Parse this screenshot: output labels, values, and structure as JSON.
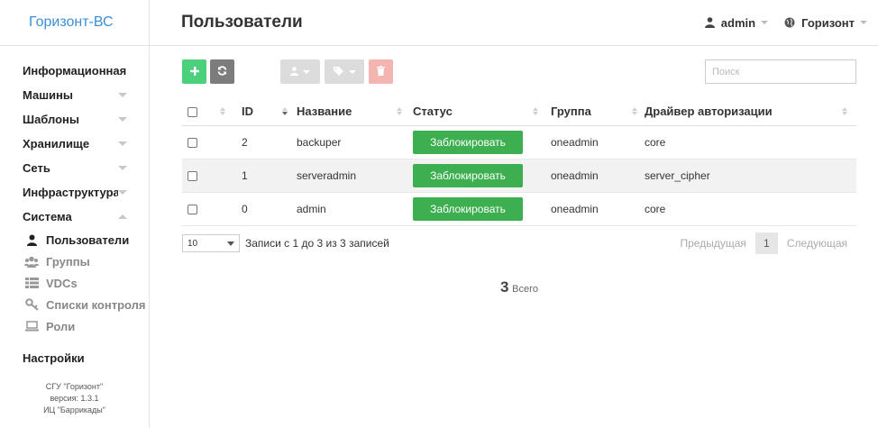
{
  "sidebar": {
    "brand": "Горизонт-ВС",
    "menu": [
      {
        "label": "Информационная пане"
      },
      {
        "label": "Машины"
      },
      {
        "label": "Шаблоны"
      },
      {
        "label": "Хранилище"
      },
      {
        "label": "Сеть"
      },
      {
        "label": "Инфраструктура"
      },
      {
        "label": "Система"
      }
    ],
    "sub": [
      {
        "label": "Пользователи",
        "icon": "user-icon"
      },
      {
        "label": "Группы",
        "icon": "users-icon"
      },
      {
        "label": "VDCs",
        "icon": "list-icon"
      },
      {
        "label": "Списки контроля",
        "icon": "key-icon"
      },
      {
        "label": "Роли",
        "icon": "laptop-icon"
      }
    ],
    "settings": "Настройки",
    "footer": {
      "line1": "СГУ \"Горизонт\"",
      "line2": "версия: 1.3.1",
      "line3": "ИЦ \"Баррикады\""
    }
  },
  "header": {
    "title": "Пользователи",
    "user": "admin",
    "zone": "Горизонт"
  },
  "search": {
    "placeholder": "Поиск"
  },
  "table": {
    "columns": [
      "ID",
      "Название",
      "Статус",
      "Группа",
      "Драйвер авторизации"
    ],
    "rows": [
      {
        "id": "2",
        "name": "backuper",
        "status": "Заблокировать",
        "group": "oneadmin",
        "driver": "core"
      },
      {
        "id": "1",
        "name": "serveradmin",
        "status": "Заблокировать",
        "group": "oneadmin",
        "driver": "server_cipher"
      },
      {
        "id": "0",
        "name": "admin",
        "status": "Заблокировать",
        "group": "oneadmin",
        "driver": "core"
      }
    ]
  },
  "pagination": {
    "page_length": "10",
    "info": "Записи с 1 до 3 из 3 записей",
    "prev": "Предыдущая",
    "page": "1",
    "next": "Следующая"
  },
  "total": {
    "count": "3",
    "label": "Всего"
  },
  "colors": {
    "brand": "#3b8fd4",
    "add": "#4bd07b",
    "status": "#3daf51",
    "delete": "#f4b5b0"
  }
}
